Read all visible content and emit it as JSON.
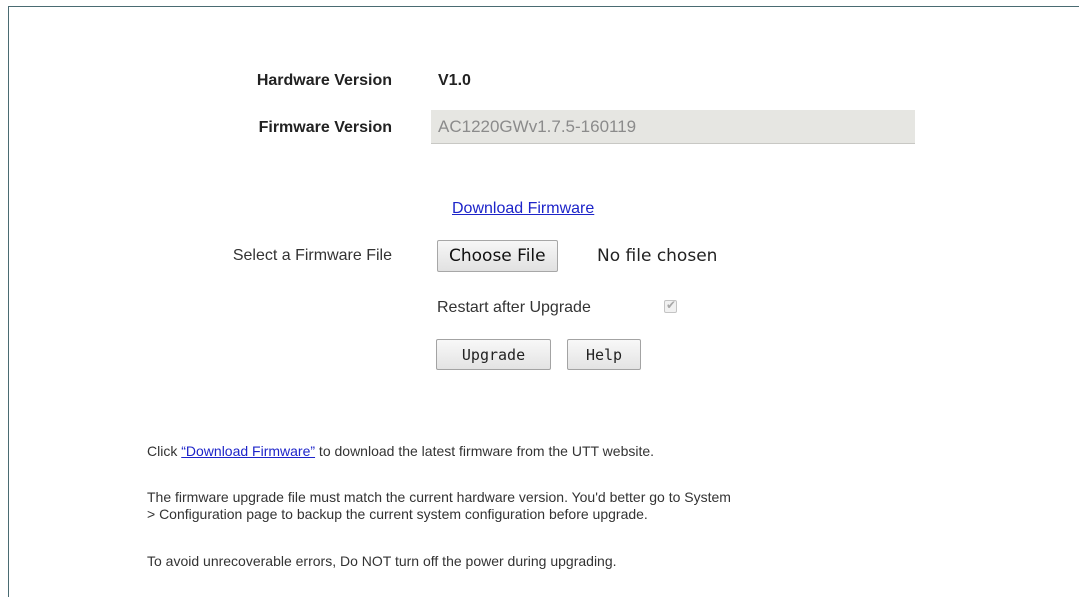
{
  "hardware": {
    "label": "Hardware Version",
    "value": "V1.0"
  },
  "firmware": {
    "label": "Firmware Version",
    "value": "AC1220GWv1.7.5-160119"
  },
  "download_link": "Download Firmware",
  "file_select": {
    "label": "Select a Firmware File",
    "button": "Choose File",
    "status": "No file chosen"
  },
  "restart": {
    "label": "Restart after Upgrade",
    "checked": true
  },
  "buttons": {
    "upgrade": "Upgrade",
    "help": "Help"
  },
  "notes": {
    "note1_prefix": "Click ",
    "note1_link": "“Download Firmware”",
    "note1_suffix": " to download the latest firmware from the UTT website.",
    "note2_line1": "The firmware upgrade file must match the current hardware version. You'd better go to System",
    "note2_line2": "> Configuration page to backup the current system configuration before upgrade.",
    "note3": "To avoid unrecoverable errors, Do NOT turn off the power during upgrading."
  }
}
